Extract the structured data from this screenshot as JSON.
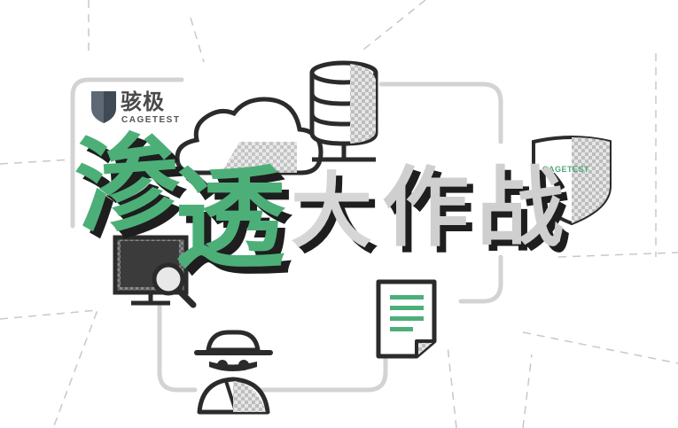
{
  "logo": {
    "name_cn": "骇极",
    "name_en": "CAGETEST"
  },
  "shield": {
    "label": "CAGETEST"
  },
  "title": {
    "chars": [
      "渗",
      "透",
      "大",
      "作",
      "战"
    ]
  },
  "colors": {
    "accent_green": "#4caf78",
    "dark": "#2b2b2b",
    "gray": "#cfcfcf",
    "line": "#d6d6d6"
  },
  "icons": [
    "cloud-icon",
    "database-icon",
    "shield-icon",
    "monitor-icon",
    "magnifier-icon",
    "document-icon",
    "spy-icon"
  ]
}
